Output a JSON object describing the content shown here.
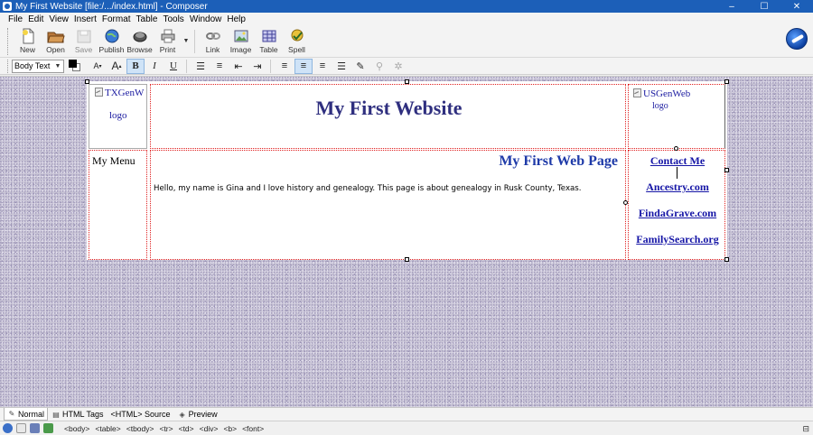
{
  "window": {
    "title": "My First Website [file:/.../index.html] - Composer",
    "controls": [
      "–",
      "☐",
      "✕"
    ]
  },
  "menubar": [
    "File",
    "Edit",
    "View",
    "Insert",
    "Format",
    "Table",
    "Tools",
    "Window",
    "Help"
  ],
  "toolbar": {
    "buttons": [
      {
        "label": "New",
        "icon": "new-page-icon",
        "enabled": true
      },
      {
        "label": "Open",
        "icon": "open-folder-icon",
        "enabled": true
      },
      {
        "label": "Save",
        "icon": "save-icon",
        "enabled": false
      },
      {
        "label": "Publish",
        "icon": "publish-globe-icon",
        "enabled": true
      },
      {
        "label": "Browse",
        "icon": "browse-icon",
        "enabled": true
      },
      {
        "label": "Print",
        "icon": "printer-icon",
        "enabled": true
      },
      {
        "label": "Link",
        "icon": "link-icon",
        "enabled": true
      },
      {
        "label": "Image",
        "icon": "image-icon",
        "enabled": true
      },
      {
        "label": "Table",
        "icon": "table-icon",
        "enabled": true
      },
      {
        "label": "Spell",
        "icon": "spell-check-icon",
        "enabled": true
      }
    ]
  },
  "format": {
    "paragraph_style": "Body Text",
    "text_color": "#000000",
    "bg_color": "#ffffff"
  },
  "document": {
    "logo_left_alt": "TXGenW",
    "logo_left_sub": "logo",
    "site_title": "My First Website",
    "logo_right_alt": "USGenWeb",
    "logo_right_sub": "logo",
    "menu_label": "My Menu",
    "page_heading": "My First Web Page",
    "body_text": "Hello, my name is Gina and I love history and genealogy. This page is about genealogy in Rusk County, Texas.",
    "links": [
      "Contact Me",
      "Ancestry.com",
      "FindaGrave.com",
      "FamilySearch.org"
    ],
    "colors": {
      "title": "#2f2f7f",
      "heading": "#1e3aa8",
      "link": "#1515a6",
      "cell_border": "#e02020"
    }
  },
  "mode_tabs": {
    "normal": "Normal",
    "html_tags": "HTML Tags",
    "source": "<HTML> Source",
    "preview": "Preview",
    "active": "Normal"
  },
  "status": {
    "tag_path": [
      "<body>",
      "<table>",
      "<tbody>",
      "<tr>",
      "<td>",
      "<div>",
      "<b>",
      "<font>"
    ]
  }
}
